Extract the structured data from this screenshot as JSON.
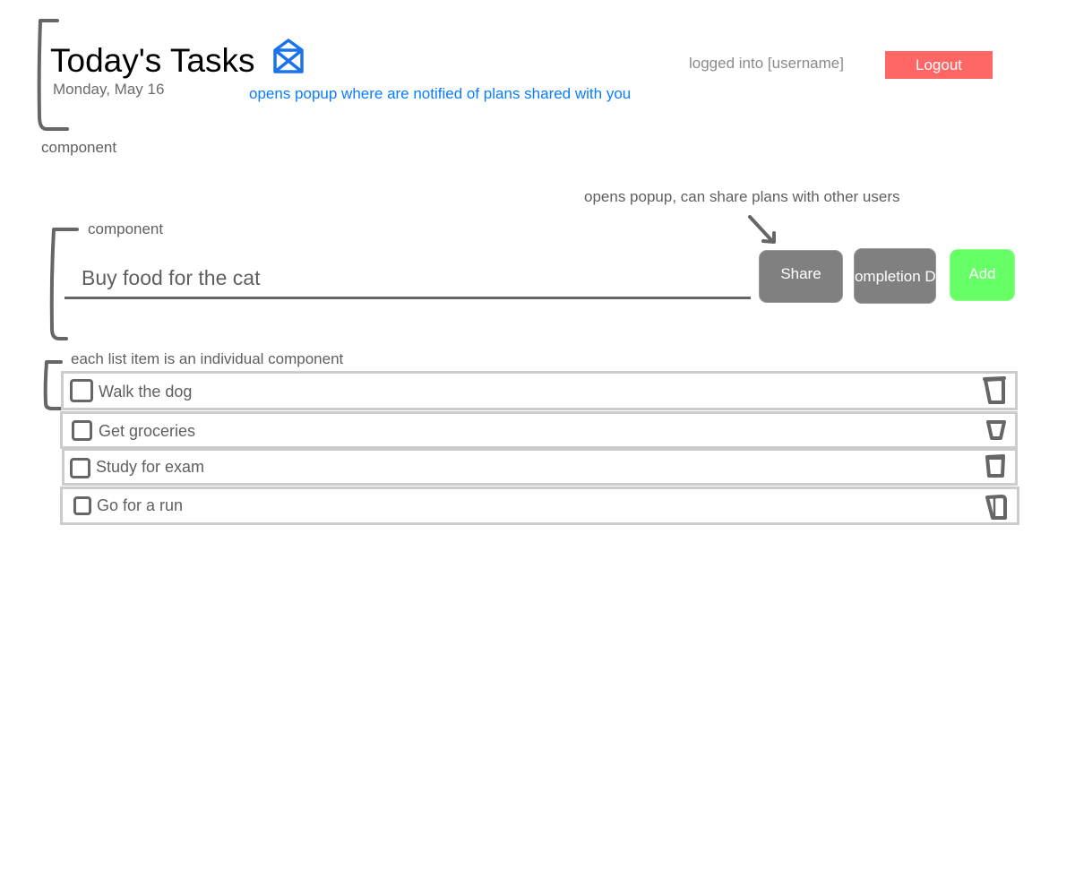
{
  "header": {
    "title": "Today's Tasks",
    "date": "Monday, May 16",
    "mail_icon": "envelope-icon",
    "mail_note": "opens popup where are notified of plans shared with you",
    "logged_in_text": "logged into [username]",
    "logout_label": "Logout",
    "component_label": "component"
  },
  "input_section": {
    "component_label": "component",
    "share_note": "opens popup, can share plans with other users",
    "task_input_value": "Buy food for the cat",
    "share_label": "Share",
    "completion_label": "Completion Date",
    "add_label": "Add"
  },
  "list": {
    "note": "each list item is an individual component",
    "items": [
      {
        "label": "Walk the dog",
        "checked": false
      },
      {
        "label": "Get groceries",
        "checked": false
      },
      {
        "label": "Study for exam",
        "checked": false
      },
      {
        "label": "Go for a run",
        "checked": false
      }
    ],
    "delete_icon": "trash-icon",
    "checkbox_icon": "checkbox-icon"
  },
  "colors": {
    "accent_blue": "#0a7cff",
    "logout_red": "#ff6666",
    "add_green": "#66ff66",
    "button_gray": "#808080",
    "border_gray": "#cccccc",
    "sketch_gray": "#666666"
  }
}
